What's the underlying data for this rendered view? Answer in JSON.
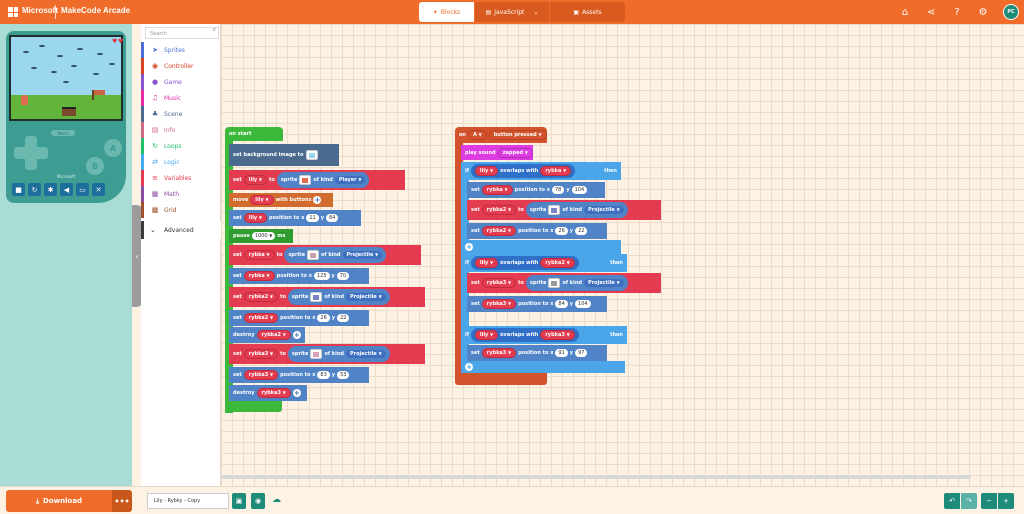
{
  "header": {
    "brand": "Microsoft",
    "app_title": "MakeCode Arcade",
    "tabs": {
      "blocks": "Blocks",
      "javascript": "JavaScript",
      "assets": "Assets"
    },
    "avatar_initials": "PC"
  },
  "simulator": {
    "menu_label": "Menu",
    "brand": "Microsoft",
    "a_label": "A",
    "b_label": "B"
  },
  "toolbox": {
    "search_placeholder": "Search",
    "categories": [
      {
        "label": "Sprites",
        "color": "#4b6fd4",
        "icon": "paper-plane-icon"
      },
      {
        "label": "Controller",
        "color": "#d54322",
        "icon": "gamepad-icon"
      },
      {
        "label": "Game",
        "color": "#8854d0",
        "icon": "circle-icon"
      },
      {
        "label": "Music",
        "color": "#e62ba7",
        "icon": "headphones-icon"
      },
      {
        "label": "Scene",
        "color": "#4b6b8e",
        "icon": "tree-icon"
      },
      {
        "label": "Info",
        "color": "#cf6a87",
        "icon": "id-card-icon"
      },
      {
        "label": "Loops",
        "color": "#20bf6b",
        "icon": "refresh-icon"
      },
      {
        "label": "Logic",
        "color": "#45aaf2",
        "icon": "shuffle-icon"
      },
      {
        "label": "Variables",
        "color": "#e33b4f",
        "icon": "list-icon"
      },
      {
        "label": "Math",
        "color": "#8a4ea0",
        "icon": "calculator-icon"
      },
      {
        "label": "Grid",
        "color": "#a0522d",
        "icon": "grid-icon"
      }
    ],
    "advanced": "Advanced"
  },
  "blocks_left": {
    "on_start": "on start",
    "set_bg": "set background image to",
    "set": "set",
    "to": "to",
    "sprite": "sprite",
    "of_kind": "of kind",
    "position_to_x": "position to x",
    "y": "y",
    "move": "move",
    "with_buttons": "with buttons",
    "pause": "pause",
    "ms": "ms",
    "destroy": "destroy",
    "lily": "lily",
    "rybka": "rybka",
    "rybka2": "rybka2",
    "rybka3": "rybka3",
    "player": "Player",
    "projectile": "Projectile",
    "lily_x": "11",
    "lily_y": "84",
    "pause_ms": "1000",
    "rybka_x": "125",
    "rybka_y": "70",
    "rybka2_x": "26",
    "rybka2_y": "22",
    "rybka3_x": "83",
    "rybka3_y": "53"
  },
  "blocks_right": {
    "on_btn": "on",
    "button_label": "A",
    "button_pressed": "button pressed",
    "play_sound": "play sound",
    "sound_name": "zapped",
    "if": "if",
    "overlaps_with": "overlaps with",
    "then": "then",
    "r1_x": "78",
    "r1_y": "104",
    "r2_x": "26",
    "r2_y": "22",
    "r3_x": "84",
    "r3_y": "104",
    "r4_x": "91",
    "r4_y": "97"
  },
  "bottombar": {
    "download": "Download",
    "more": "•••",
    "project_name": "Lily - Rybky - Copy"
  }
}
